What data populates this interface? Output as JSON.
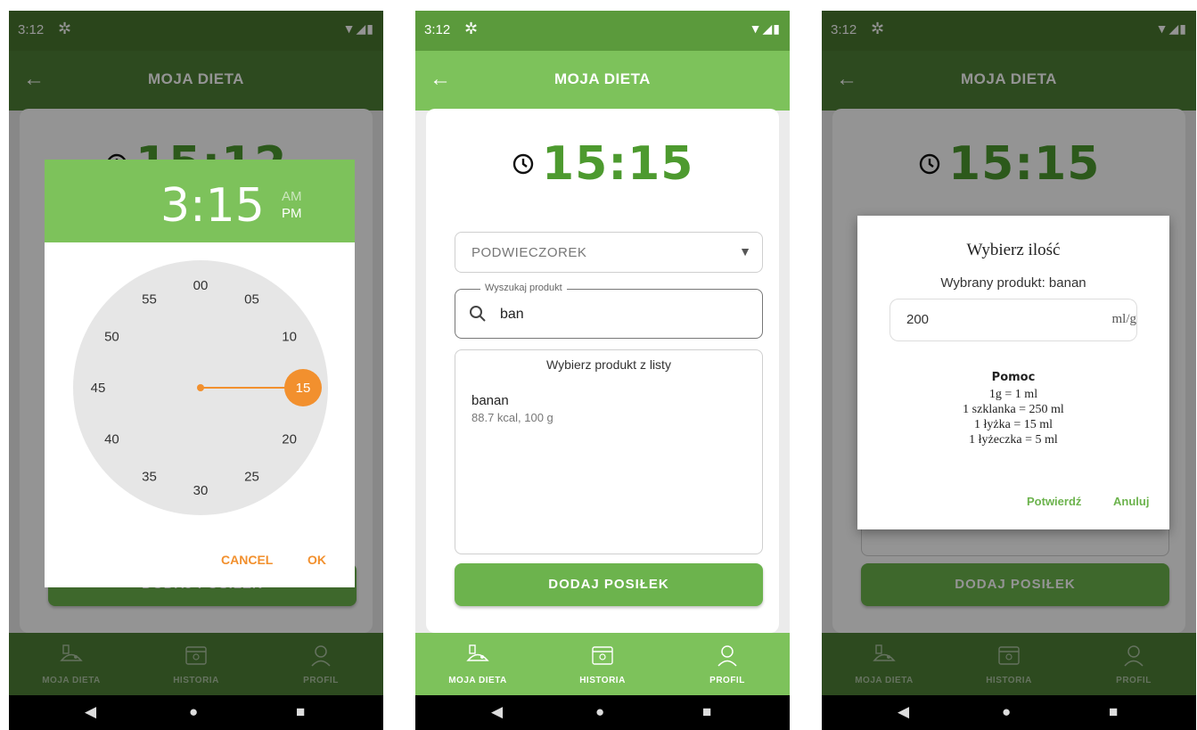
{
  "status": {
    "time": "3:12"
  },
  "appbar": {
    "title": "MOJA DIETA"
  },
  "main": {
    "clock_time": "15:15",
    "clock_time_prev": "15:12",
    "meal_select": "PODWIECZOREK",
    "search_legend": "Wyszukaj produkt",
    "search_value": "ban",
    "list_header": "Wybierz produkt z listy",
    "products": [
      {
        "name": "banan",
        "info": "88.7 kcal, 100 g"
      }
    ],
    "add_button": "DODAJ POSIŁEK"
  },
  "nav": [
    {
      "label": "MOJA DIETA",
      "icon": "diet-icon"
    },
    {
      "label": "HISTORIA",
      "icon": "calendar-icon"
    },
    {
      "label": "PROFIL",
      "icon": "profile-icon"
    }
  ],
  "picker": {
    "time": "3:15",
    "am": "AM",
    "pm": "PM",
    "minutes": [
      "00",
      "05",
      "10",
      "15",
      "20",
      "25",
      "30",
      "35",
      "40",
      "45",
      "50",
      "55"
    ],
    "selected_minute": "15",
    "cancel": "CANCEL",
    "ok": "OK"
  },
  "quantity": {
    "title": "Wybierz ilość",
    "product_label": "Wybrany produkt: banan",
    "value": "200",
    "unit": "ml/g",
    "help_title": "Pomoc",
    "help_lines": [
      "1g = 1 ml",
      "1 szklanka = 250 ml",
      "1 łyżka = 15 ml",
      "1 łyżeczka = 5 ml"
    ],
    "confirm": "Potwierdź",
    "cancel": "Anuluj"
  },
  "colors": {
    "accent": "#7dc25b",
    "dark": "#4e8036",
    "orange": "#f2902e",
    "clock": "#4d9a2f"
  }
}
